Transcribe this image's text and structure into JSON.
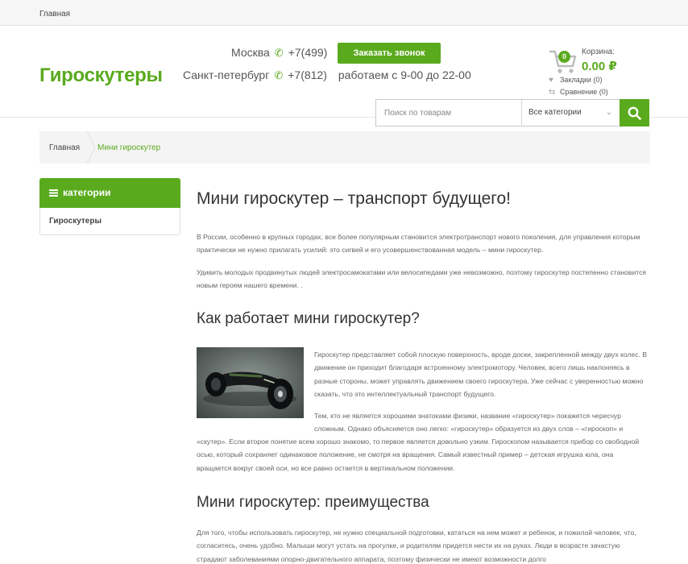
{
  "topbar": {
    "home_link": "Главная"
  },
  "header": {
    "logo": "Гироскутеры",
    "contacts": [
      {
        "city": "Москва",
        "phone": "+7(499)"
      },
      {
        "city": "Санкт-петербург",
        "phone": "+7(812)"
      }
    ],
    "hours": "работаем с 9-00 до 22-00",
    "callback_button": "Заказать звонок",
    "cart": {
      "count": "0",
      "label": "Корзина:",
      "sum": "0.00 ₽"
    },
    "bookmarks": "Закладки (0)",
    "compare": "Сравнение (0)",
    "search": {
      "placeholder": "Поиск по товарам",
      "category": "Все категории"
    }
  },
  "breadcrumbs": [
    "Главная",
    "Мини гироскутер"
  ],
  "sidebar": {
    "title": "категории",
    "items": [
      "Гироскутеры"
    ]
  },
  "article": {
    "title": "Мини гироскутер – транспорт будущего!",
    "p1": "В России, особенно в крупных городах, все более популярным становится электротранспорт нового поколения, для управления которым практически не нужно прилагать усилий: это сигвей и его усовершенствованная модель – мини гироскутер.",
    "p2": "Удивить молодых продвинутых людей электросамокатами или велосипедами уже невозможно, поэтому гироскутер постепенно становится новым героем нашего времени. .",
    "h2_1": "Как работает мини гироскутер?",
    "p3": "Гироскутер представляет собой плоскую поверхность, вроде доски, закрепленной между двух колес. В движение он приходит благодаря встроенному электромотору. Человек, всего лишь наклоняясь в разные стороны, может управлять движением своего гироскутера. Уже сейчас с уверенностью можно сказать, что это интеллектуальный транспорт будущего.",
    "p4a": "Тем, кто не является хорошими знатоками физики, название «гироскутер» покажется чересчур сложным. Однако объясняется оно легко: «гироскутер» образуется из двух слов – «гироскоп» и",
    "p4b": "«скутер». Если второе понятие всем хорошо знакомо, то первое является довольно узким. Гироскопом называется прибор со свободной осью, который сохраняет одинаковое положение, не смотря на вращения. Самый известный пример – детская игрушка юла, она вращается вокруг своей оси, но все равно остается в вертикальном положении.",
    "h2_2": "Мини гироскутер: преимущества",
    "p5": "Для того, чтобы использовать гироскутер, не нужно специальной подготовки, кататься на нем может и ребенок, и пожилой человек, что, согласитесь, очень удобно. Малыши могут устать на прогулке, и родителям придется нести их на руках. Люди в возрасте зачастую страдают заболеваниями опорно-двигательного аппарата, поэтому физически не имеют возможности долго"
  },
  "colors": {
    "accent": "#5aaa1e"
  }
}
